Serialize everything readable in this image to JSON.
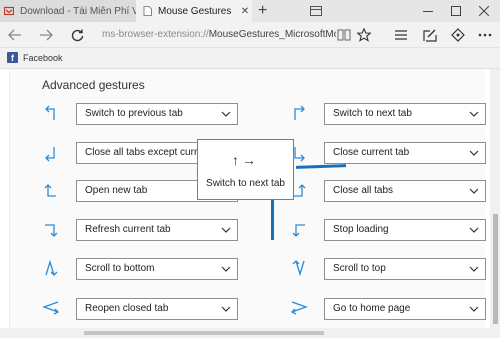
{
  "tabs": [
    {
      "title": "Download - Tài Miễn Phí VN",
      "active": false
    },
    {
      "title": "Mouse Gestures",
      "active": true
    }
  ],
  "address": {
    "prefix": "ms-browser-extension://",
    "rest": "MouseGestures_MicrosoftMouseGe"
  },
  "favorites": [
    {
      "label": "Facebook",
      "icon": "facebook-icon"
    }
  ],
  "section": {
    "title": "Advanced gestures"
  },
  "gestures_left": [
    {
      "icon": "arrow-up-left-icon",
      "value": "Switch to previous tab"
    },
    {
      "icon": "arrow-down-left-icon",
      "value": "Close all tabs except current"
    },
    {
      "icon": "arrow-up-right-icon",
      "value": "Open new tab"
    },
    {
      "icon": "arrow-right-down-icon",
      "value": "Refresh current tab"
    },
    {
      "icon": "arrow-up-down-icon",
      "value": "Scroll to bottom"
    },
    {
      "icon": "arrow-left-right-icon",
      "value": "Reopen closed tab"
    }
  ],
  "gestures_right": [
    {
      "icon": "arrow-up-right-corner-icon",
      "value": "Switch to next tab"
    },
    {
      "icon": "arrow-down-right-icon",
      "value": "Close current tab"
    },
    {
      "icon": "arrow-up-left-corner-icon",
      "value": "Close all tabs"
    },
    {
      "icon": "arrow-left-down-icon",
      "value": "Stop loading"
    },
    {
      "icon": "arrow-down-up-icon",
      "value": "Scroll to top"
    },
    {
      "icon": "arrow-right-left-icon",
      "value": "Go to home page"
    }
  ],
  "popup": {
    "arrows": "↑→",
    "text": "Switch to next tab"
  },
  "colors": {
    "accent": "#3c8ed4",
    "stroke": "#1b6fb8"
  }
}
